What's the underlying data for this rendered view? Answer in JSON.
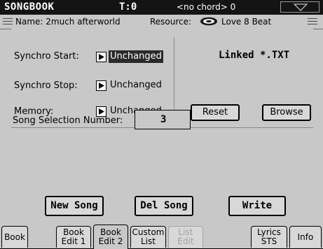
{
  "titlebar": {
    "app": "SONGBOOK",
    "tempo": "T:0",
    "chord": "<no chord> 0"
  },
  "infobar": {
    "name": "Name: 2much afterworld",
    "resource_label": "Resource:",
    "resource_value": "Love 8 Beat"
  },
  "main": {
    "synchro_start_label": "Synchro Start:",
    "synchro_start_value": "Unchanged",
    "synchro_stop_label": "Synchro Stop:",
    "synchro_stop_value": "Unchanged",
    "memory_label": "Memory:",
    "memory_value": "Unchanged",
    "linked_text": "Linked *.TXT",
    "reset_label": "Reset",
    "browse_label": "Browse",
    "song_selection_label": "Song Selection Number:",
    "song_selection_value": "3",
    "new_song_label": "New Song",
    "del_song_label": "Del Song",
    "write_label": "Write"
  },
  "tabs": [
    {
      "line1": "Book",
      "line2": ""
    },
    {
      "line1": "Book",
      "line2": "Edit 1"
    },
    {
      "line1": "Book",
      "line2": "Edit 2"
    },
    {
      "line1": "Custom",
      "line2": "List"
    },
    {
      "line1": "List",
      "line2": "Edit"
    },
    {
      "line1": "Lyrics",
      "line2": "STS"
    },
    {
      "line1": "Info",
      "line2": ""
    }
  ],
  "active_tab": "Book Edit 2",
  "colors": {
    "background": "#c8c8c8",
    "titlebar": "#141414",
    "selection": "#2a2a2a"
  }
}
